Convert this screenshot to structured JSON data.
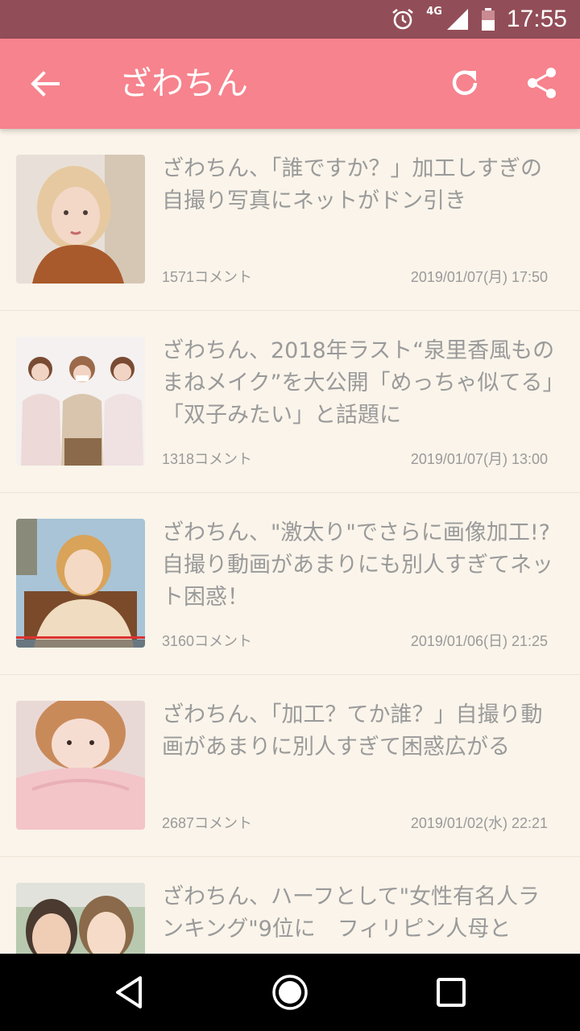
{
  "status_bar": {
    "network": "4G",
    "time": "17:55",
    "icons": [
      "alarm-icon",
      "signal-icon",
      "battery-icon"
    ]
  },
  "app_bar": {
    "title": "ざわちん",
    "back_icon": "arrow-left-icon",
    "refresh_icon": "refresh-icon",
    "share_icon": "share-icon"
  },
  "articles": [
    {
      "title": "ざわちん、「誰ですか？」加工しすぎの自撮り写真にネットがドン引き",
      "comments": "1571コメント",
      "date": "2019/01/07(月) 17:50",
      "thumbnail": "photo-woman-blonde-bob"
    },
    {
      "title": "ざわちん、2018年ラスト“泉里香風ものまねメイク”を大公開「めっちゃ似てる」「双子みたい」と話題に",
      "comments": "1318コメント",
      "date": "2019/01/07(月) 13:00",
      "thumbnail": "photo-three-women"
    },
    {
      "title": "ざわちん、\"激太り\"でさらに画像加工!? 自撮り動画があまりにも別人すぎてネット困惑！",
      "comments": "3160コメント",
      "date": "2019/01/06(日) 21:25",
      "thumbnail": "photo-video-still"
    },
    {
      "title": "ざわちん、「加工？てか誰？」自撮り動画があまりに別人すぎて困惑広がる",
      "comments": "2687コメント",
      "date": "2019/01/02(水) 22:21",
      "thumbnail": "photo-woman-pink-sweater"
    },
    {
      "title": "ざわちん、ハーフとして\"女性有名人ランキング\"9位に　フィリピン人母と",
      "comments": "",
      "date": "",
      "thumbnail": "photo-two-women"
    }
  ],
  "nav_bar": {
    "icons": [
      "back-triangle-icon",
      "home-circle-icon",
      "recents-square-icon"
    ]
  },
  "colors": {
    "status_bar": "#924e58",
    "app_bar": "#f6838d",
    "background": "#faf4ea",
    "text_gray": "#9a9a9a"
  }
}
